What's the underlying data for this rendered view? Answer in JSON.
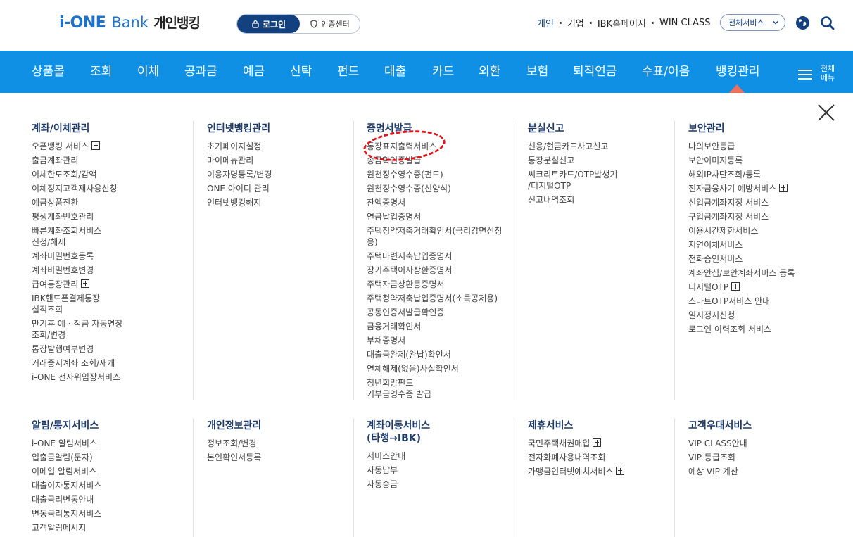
{
  "header": {
    "logo_ione": "i-ONE",
    "logo_bank": "Bank",
    "logo_personal": "개인뱅킹",
    "login_label": "로그인",
    "cert_label": "인증센터",
    "top_links": [
      "개인",
      "기업",
      "IBK홈페이지",
      "WIN CLASS"
    ],
    "all_services": "전체서비스"
  },
  "gnb": {
    "items": [
      "상품몰",
      "조회",
      "이체",
      "공과금",
      "예금",
      "신탁",
      "펀드",
      "대출",
      "카드",
      "외환",
      "보험",
      "퇴직연금",
      "수표/어음",
      "뱅킹관리"
    ],
    "all_menu_line1": "전체",
    "all_menu_line2": "메뉴"
  },
  "menu": {
    "col1": {
      "title": "계좌/이체관리",
      "items": [
        "오픈뱅킹 서비스",
        "출금계좌관리",
        "이체한도조회/감액",
        "이체정지고객재사용신청",
        "예금상품전환",
        "평생계좌번호관리",
        "빠른계좌조회서비스",
        "신청/해제",
        "계좌비밀번호등록",
        "계좌비밀번호변경",
        "급여통장관리",
        "IBK핸드폰결제통장",
        "실적조회",
        "만기후 예 · 적금 자동연장",
        "조회/변경",
        "통장발행여부변경",
        "거래중지계좌 조회/재개",
        "i-ONE 전자위임장서비스"
      ]
    },
    "col2": {
      "title": "인터넷뱅킹관리",
      "items": [
        "초기페이지설정",
        "마이메뉴관리",
        "이용자명등록/변경",
        "ONE 아이디 관리",
        "인터넷뱅킹해지"
      ]
    },
    "col3": {
      "title": "증명서발급",
      "items": [
        "통장표지출력서비스",
        "송금확인증발급",
        "원천징수영수증(펀드)",
        "원천징수영수증(신양식)",
        "잔액증명서",
        "연금납입증명서",
        "주택청약저축거래확인서(금리감면신청",
        "용)",
        "주택마련저축납입증명서",
        "장기주택이자상환증명서",
        "주택자금상환등증명서",
        "주택청약저축납입증명서(소득공제용)",
        "공동인증서발급확인증",
        "금융거래확인서",
        "부채증명서",
        "대출금완제(완납)확인서",
        "연체해제(없음)사실확인서",
        "청년희망펀드",
        "기부금영수증 발급"
      ]
    },
    "col4": {
      "title": "분실신고",
      "items": [
        "신용/현금카드사고신고",
        "통장분실신고",
        "씨크리트카드/OTP발생기",
        "/디지털OTP",
        "신고내역조회"
      ]
    },
    "col5": {
      "title": "보안관리",
      "items": [
        "나의보안등급",
        "보안이미지등록",
        "해외IP차단조회/등록",
        "전자금융사기 예방서비스",
        "신입금계좌지정 서비스",
        "구입금계좌지정 서비스",
        "이용시간제한서비스",
        "지연이체서비스",
        "전화승인서비스",
        "계좌안심/보안계좌서비스 등록",
        "디지털OTP",
        "스마트OTP서비스 안내",
        "일시정지신청",
        "로그인 이력조회 서비스"
      ]
    },
    "col6": {
      "title": "알림/통지서비스",
      "items": [
        "i-ONE 알림서비스",
        "입출금알림(문자)",
        "이메일 알림서비스",
        "대출이자통지서비스",
        "대출금리변동안내",
        "변동금리통지서비스",
        "고객알림메시지"
      ]
    },
    "col7": {
      "title": "개인정보관리",
      "items": [
        "정보조회/변경",
        "본인확인서등록"
      ]
    },
    "col8": {
      "title_line1": "계좌이동서비스",
      "title_line2": "(타행→IBK)",
      "items": [
        "서비스안내",
        "자동납부",
        "자동송금"
      ]
    },
    "col9": {
      "title": "제휴서비스",
      "items": [
        "국민주택채권매입",
        "전자화폐사용내역조회",
        "가맹금인터넷예치서비스"
      ]
    },
    "col10": {
      "title": "고객우대서비스",
      "items": [
        "VIP CLASS안내",
        "VIP 등급조회",
        "예상 VIP 계산"
      ]
    }
  },
  "colors": {
    "nav_blue": "#0f90e4",
    "navy": "#13407f",
    "highlight_red": "#e0121a"
  }
}
